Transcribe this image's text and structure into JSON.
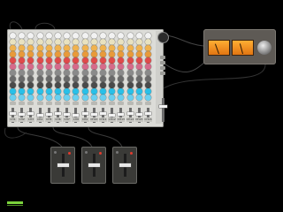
{
  "mixer": {
    "channel_count": 16,
    "knob_row_colors": [
      "#f2f2f2",
      "#e8e2c0",
      "#f0b24e",
      "#e89a3a",
      "#e04a4a",
      "#d66a8a",
      "#8a8a8a",
      "#6a6a6a",
      "#4a4a4a",
      "#28c0e8",
      "#6ad0f0"
    ],
    "channel_labels": [
      "CH1",
      "CH2",
      "CH3",
      "CH4",
      "CH5",
      "CH6",
      "CH7",
      "CH8",
      "CH9",
      "CH10",
      "CH11",
      "CH12",
      "CH13",
      "CH14",
      "CH15",
      "CH16"
    ]
  },
  "vu": {
    "title": "",
    "meter_color": "#f08a1e"
  },
  "modules": [
    {
      "label": ""
    },
    {
      "label": ""
    },
    {
      "label": ""
    }
  ],
  "colors": {
    "background": "#000000",
    "panel": "#dcdcd8",
    "accent_level": "#7bd23c"
  },
  "icons": {
    "knob": "rotary-knob-icon",
    "led": "led-indicator-icon"
  }
}
